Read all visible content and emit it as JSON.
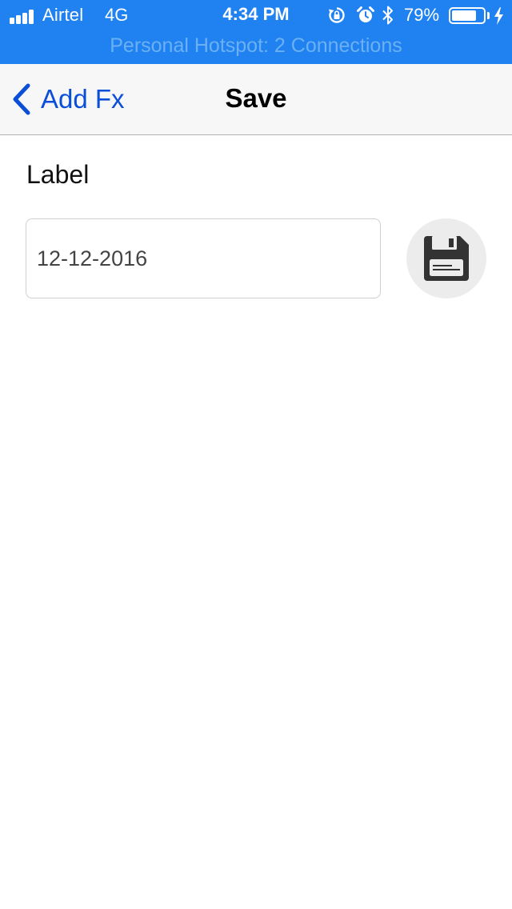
{
  "colors": {
    "status_bar_bg": "#1f82f0",
    "link": "#0b4fd9",
    "hotspot_text": "#6cb0f4"
  },
  "status_bar": {
    "carrier": "Airtel",
    "network": "4G",
    "time": "4:34 PM",
    "battery_percent_label": "79%",
    "battery_level": 0.79,
    "signal_bars_filled": 4,
    "icons": [
      "signal-icon",
      "rotation-lock-icon",
      "alarm-icon",
      "bluetooth-icon",
      "battery-icon",
      "charging-icon"
    ]
  },
  "hotspot_banner": {
    "text": "Personal Hotspot: 2 Connections"
  },
  "nav": {
    "back_label": "Add Fx",
    "back_icon": "chevron-left-icon",
    "title": "Save"
  },
  "form": {
    "label": "Label",
    "date_value": "12-12-2016",
    "save_icon": "floppy-disk-icon"
  }
}
